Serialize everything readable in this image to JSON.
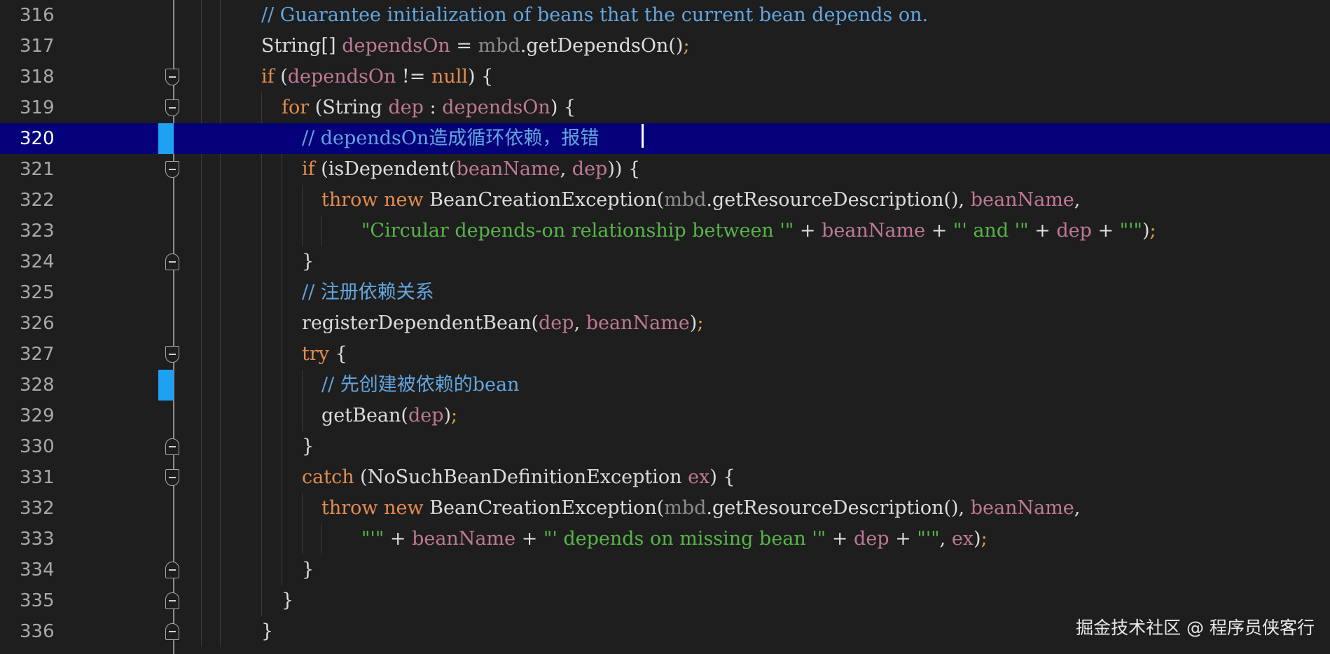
{
  "editor": {
    "current_line": 320,
    "lines": [
      {
        "n": "316",
        "tokens": [
          [
            "cm",
            "// Guarantee initialization of beans that the current bean depends on."
          ]
        ]
      },
      {
        "n": "317",
        "tokens": [
          [
            "plain",
            "String[] "
          ],
          [
            "var",
            "dependsOn"
          ],
          [
            "plain",
            " = "
          ],
          [
            "dim",
            "mbd"
          ],
          [
            "plain",
            ".getDependsOn()"
          ],
          [
            "semi",
            ";"
          ]
        ]
      },
      {
        "n": "318",
        "tokens": [
          [
            "kw",
            "if"
          ],
          [
            "plain",
            " ("
          ],
          [
            "var",
            "dependsOn"
          ],
          [
            "plain",
            " != "
          ],
          [
            "kw",
            "null"
          ],
          [
            "plain",
            ") {"
          ]
        ]
      },
      {
        "n": "319",
        "tokens": [
          [
            "kw",
            "for"
          ],
          [
            "plain",
            " (String "
          ],
          [
            "var",
            "dep"
          ],
          [
            "plain",
            " : "
          ],
          [
            "var",
            "dependsOn"
          ],
          [
            "plain",
            ") {"
          ]
        ]
      },
      {
        "n": "320",
        "tokens": [
          [
            "cm",
            "// dependsOn造成循环依赖，报错"
          ]
        ]
      },
      {
        "n": "321",
        "tokens": [
          [
            "kw",
            "if"
          ],
          [
            "plain",
            " (isDependent("
          ],
          [
            "var",
            "beanName"
          ],
          [
            "plain",
            ", "
          ],
          [
            "var",
            "dep"
          ],
          [
            "plain",
            ")) {"
          ]
        ]
      },
      {
        "n": "322",
        "tokens": [
          [
            "kw",
            "throw"
          ],
          [
            "plain",
            " "
          ],
          [
            "kw",
            "new"
          ],
          [
            "plain",
            " BeanCreationException("
          ],
          [
            "dim",
            "mbd"
          ],
          [
            "plain",
            ".getResourceDescription(), "
          ],
          [
            "var",
            "beanName"
          ],
          [
            "plain",
            ","
          ]
        ]
      },
      {
        "n": "323",
        "tokens": [
          [
            "str",
            "\"Circular depends-on relationship between '\""
          ],
          [
            "plain",
            " + "
          ],
          [
            "var",
            "beanName"
          ],
          [
            "plain",
            " + "
          ],
          [
            "str",
            "\"' and '\""
          ],
          [
            "plain",
            " + "
          ],
          [
            "var",
            "dep"
          ],
          [
            "plain",
            " + "
          ],
          [
            "str",
            "\"'\""
          ],
          [
            "plain",
            ")"
          ],
          [
            "semi",
            ";"
          ]
        ]
      },
      {
        "n": "324",
        "tokens": [
          [
            "plain",
            "}"
          ]
        ]
      },
      {
        "n": "325",
        "tokens": [
          [
            "cm",
            "// 注册依赖关系"
          ]
        ]
      },
      {
        "n": "326",
        "tokens": [
          [
            "plain",
            "registerDependentBean("
          ],
          [
            "var",
            "dep"
          ],
          [
            "plain",
            ", "
          ],
          [
            "var",
            "beanName"
          ],
          [
            "plain",
            ")"
          ],
          [
            "semi",
            ";"
          ]
        ]
      },
      {
        "n": "327",
        "tokens": [
          [
            "kw",
            "try"
          ],
          [
            "plain",
            " {"
          ]
        ]
      },
      {
        "n": "328",
        "tokens": [
          [
            "cm",
            "// 先创建被依赖的bean"
          ]
        ]
      },
      {
        "n": "329",
        "tokens": [
          [
            "plain",
            "getBean("
          ],
          [
            "var",
            "dep"
          ],
          [
            "plain",
            ")"
          ],
          [
            "semi",
            ";"
          ]
        ]
      },
      {
        "n": "330",
        "tokens": [
          [
            "plain",
            "}"
          ]
        ]
      },
      {
        "n": "331",
        "tokens": [
          [
            "kw",
            "catch"
          ],
          [
            "plain",
            " (NoSuchBeanDefinitionException "
          ],
          [
            "var",
            "ex"
          ],
          [
            "plain",
            ") {"
          ]
        ]
      },
      {
        "n": "332",
        "tokens": [
          [
            "kw",
            "throw"
          ],
          [
            "plain",
            " "
          ],
          [
            "kw",
            "new"
          ],
          [
            "plain",
            " BeanCreationException("
          ],
          [
            "dim",
            "mbd"
          ],
          [
            "plain",
            ".getResourceDescription(), "
          ],
          [
            "var",
            "beanName"
          ],
          [
            "plain",
            ","
          ]
        ]
      },
      {
        "n": "333",
        "tokens": [
          [
            "str",
            "\"'\""
          ],
          [
            "plain",
            " + "
          ],
          [
            "var",
            "beanName"
          ],
          [
            "plain",
            " + "
          ],
          [
            "str",
            "\"' depends on missing bean '\""
          ],
          [
            "plain",
            " + "
          ],
          [
            "var",
            "dep"
          ],
          [
            "plain",
            " + "
          ],
          [
            "str",
            "\"'\""
          ],
          [
            "plain",
            ", "
          ],
          [
            "var",
            "ex"
          ],
          [
            "plain",
            ")"
          ],
          [
            "semi",
            ";"
          ]
        ]
      },
      {
        "n": "334",
        "tokens": [
          [
            "plain",
            "}"
          ]
        ]
      },
      {
        "n": "335",
        "tokens": [
          [
            "plain",
            "}"
          ]
        ]
      },
      {
        "n": "336",
        "tokens": [
          [
            "plain",
            "}"
          ]
        ]
      }
    ]
  },
  "watermark": "掘金技术社区 @ 程序员侠客行",
  "colors": {
    "background": "#1e1e1e",
    "current_line": "#04007a",
    "keyword": "#e38c4f",
    "variable": "#c07898",
    "comment": "#62a6df",
    "string": "#57b548",
    "bookmark": "#1da1f2"
  }
}
